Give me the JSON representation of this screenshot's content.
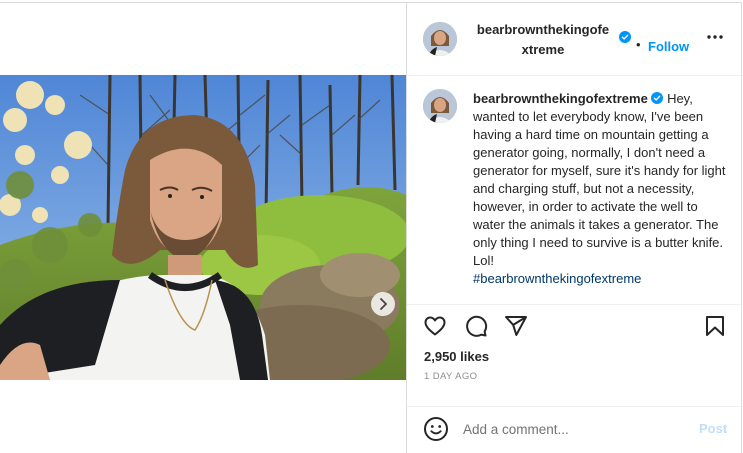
{
  "post": {
    "username": "bearbrownthekingofextreme",
    "header_username_line1": "bearbrownthekingofe",
    "header_username_line2": "xtreme",
    "follow_label": "Follow",
    "bullet": "•",
    "caption_text": " Hey, wanted to let everybody know, I've been having a hard time on mountain getting a generator going, normally, I don't need a generator for myself, sure it's handy for light and charging stuff, but not a necessity, however, in order to activate the well to water the animals it takes a generator. The only thing I need to survive is a butter knife. Lol!",
    "hashtag": "#bearbrownthekingofextreme",
    "likes": "2,950 likes",
    "time_ago": "1 DAY AGO"
  },
  "comment": {
    "placeholder": "Add a comment...",
    "post_label": "Post"
  },
  "icons": {
    "more": "more-options-icon",
    "verified": "verified-badge-icon",
    "like": "heart-icon",
    "comment": "comment-bubble-icon",
    "share": "paper-plane-icon",
    "save": "bookmark-icon",
    "emoji": "smiley-icon",
    "next": "chevron-right-icon"
  },
  "colors": {
    "accent": "#0095f6",
    "verified": "#0095f6",
    "hashtag": "#00376b",
    "muted": "#8e8e8e",
    "post_disabled": "#c0dffd"
  },
  "carousel": {
    "total_slides": 2,
    "active_slide": 1
  }
}
